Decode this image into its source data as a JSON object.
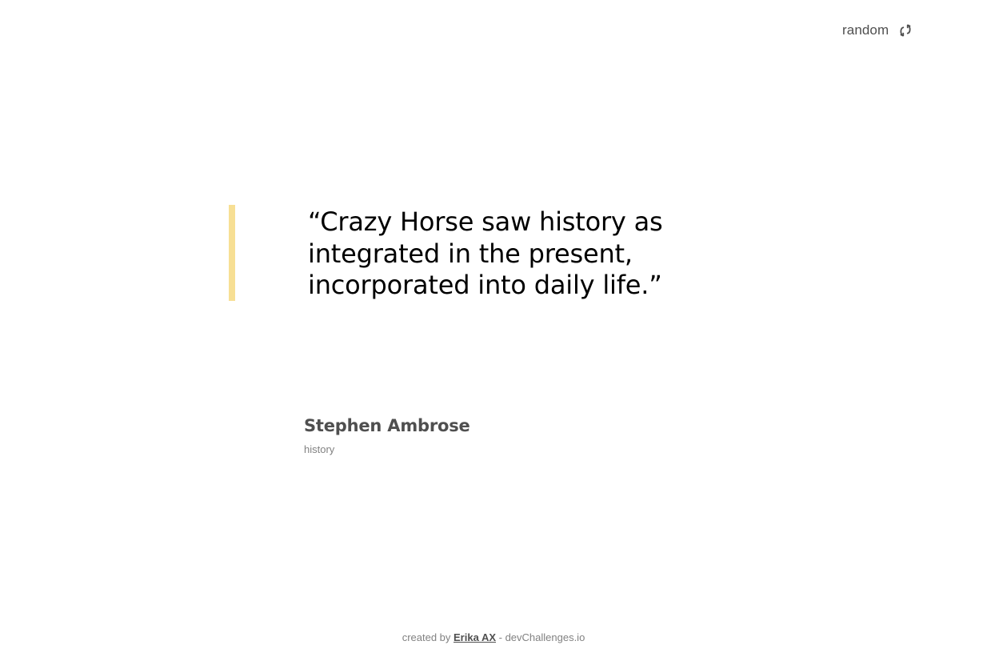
{
  "header": {
    "random_label": "random",
    "random_icon": "refresh-icon"
  },
  "quote": {
    "text": "“Crazy Horse saw history as integrated in the present, incorporated into daily life.”",
    "accent_color": "#f7df94"
  },
  "author": {
    "name": "Stephen Ambrose",
    "genre": "history"
  },
  "footer": {
    "prefix": "created by ",
    "author_link": "Erika AX",
    "suffix": " - devChallenges.io"
  }
}
